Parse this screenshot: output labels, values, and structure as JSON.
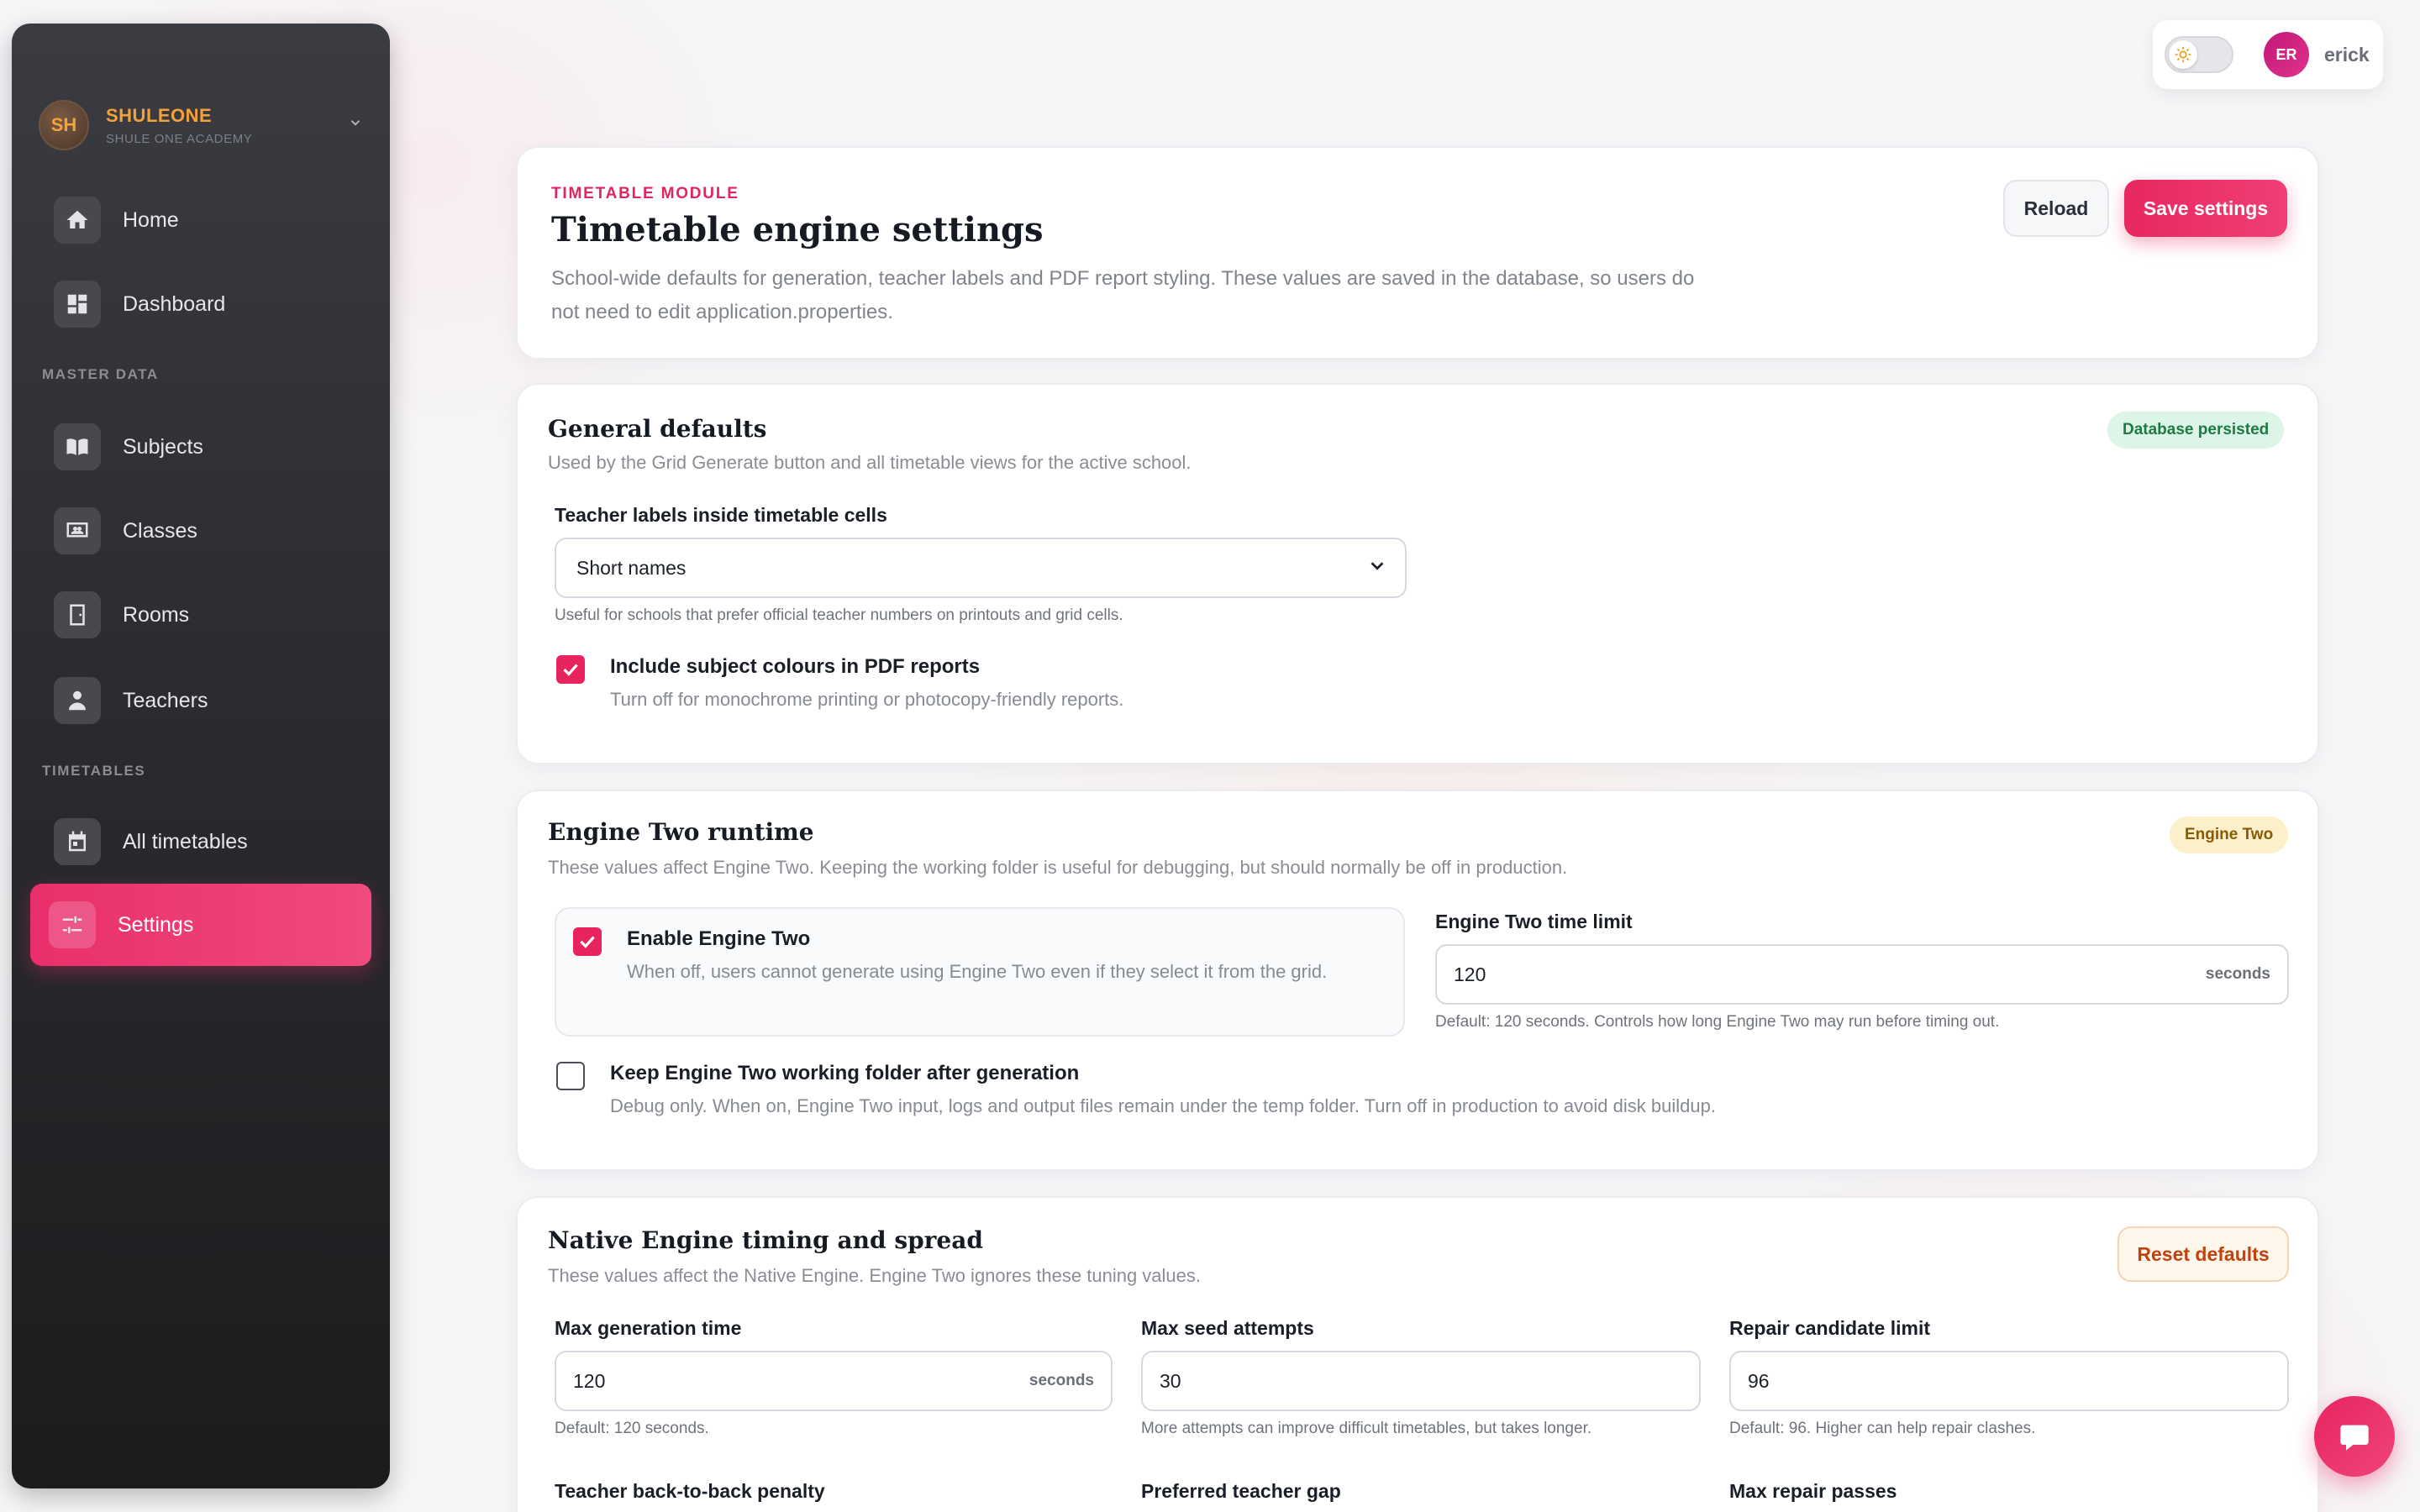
{
  "brand": {
    "initials": "SH",
    "name": "SHULEONE",
    "subtitle": "SHULE ONE ACADEMY"
  },
  "nav": {
    "home": "Home",
    "dashboard": "Dashboard",
    "master_data_label": "MASTER DATA",
    "subjects": "Subjects",
    "classes": "Classes",
    "rooms": "Rooms",
    "teachers": "Teachers",
    "timetables_label": "TIMETABLES",
    "all_timetables": "All timetables",
    "settings": "Settings"
  },
  "user": {
    "initials": "ER",
    "name": "erick"
  },
  "header": {
    "eyebrow": "TIMETABLE MODULE",
    "title": "Timetable engine settings",
    "description": "School-wide defaults for generation, teacher labels and PDF report styling. These values are saved in the database, so users do not need to edit application.properties.",
    "reload_label": "Reload",
    "save_label": "Save settings"
  },
  "general": {
    "title": "General defaults",
    "description": "Used by the Grid Generate button and all timetable views for the active school.",
    "badge": "Database persisted",
    "teacher_labels_label": "Teacher labels inside timetable cells",
    "teacher_labels_value": "Short names",
    "teacher_labels_help": "Useful for schools that prefer official teacher numbers on printouts and grid cells.",
    "subject_colours_label": "Include subject colours in PDF reports",
    "subject_colours_help": "Turn off for monochrome printing or photocopy-friendly reports.",
    "subject_colours_checked": true
  },
  "engine_two": {
    "title": "Engine Two runtime",
    "description": "These values affect Engine Two. Keeping the working folder is useful for debugging, but should normally be off in production.",
    "badge": "Engine Two",
    "enable_label": "Enable Engine Two",
    "enable_help": "When off, users cannot generate using Engine Two even if they select it from the grid.",
    "enable_checked": true,
    "time_limit_label": "Engine Two time limit",
    "time_limit_value": "120",
    "time_limit_unit": "seconds",
    "time_limit_help": "Default: 120 seconds. Controls how long Engine Two may run before timing out.",
    "keep_folder_label": "Keep Engine Two working folder after generation",
    "keep_folder_help": "Debug only. When on, Engine Two input, logs and output files remain under the temp folder. Turn off in production to avoid disk buildup.",
    "keep_folder_checked": false
  },
  "native": {
    "title": "Native Engine timing and spread",
    "description": "These values affect the Native Engine. Engine Two ignores these tuning values.",
    "reset_label": "Reset defaults",
    "max_gen_time_label": "Max generation time",
    "max_gen_time_value": "120",
    "max_gen_time_unit": "seconds",
    "max_gen_time_help": "Default: 120 seconds.",
    "max_seed_label": "Max seed attempts",
    "max_seed_value": "30",
    "max_seed_help": "More attempts can improve difficult timetables, but takes longer.",
    "repair_limit_label": "Repair candidate limit",
    "repair_limit_value": "96",
    "repair_limit_help": "Default: 96. Higher can help repair clashes.",
    "b2b_penalty_label": "Teacher back-to-back penalty",
    "pref_gap_label": "Preferred teacher gap",
    "max_repair_label": "Max repair passes"
  },
  "colors": {
    "accent": "#e8245f",
    "brand": "#f5a13a",
    "success": "#1d7a45",
    "warning": "#8a5a08"
  }
}
